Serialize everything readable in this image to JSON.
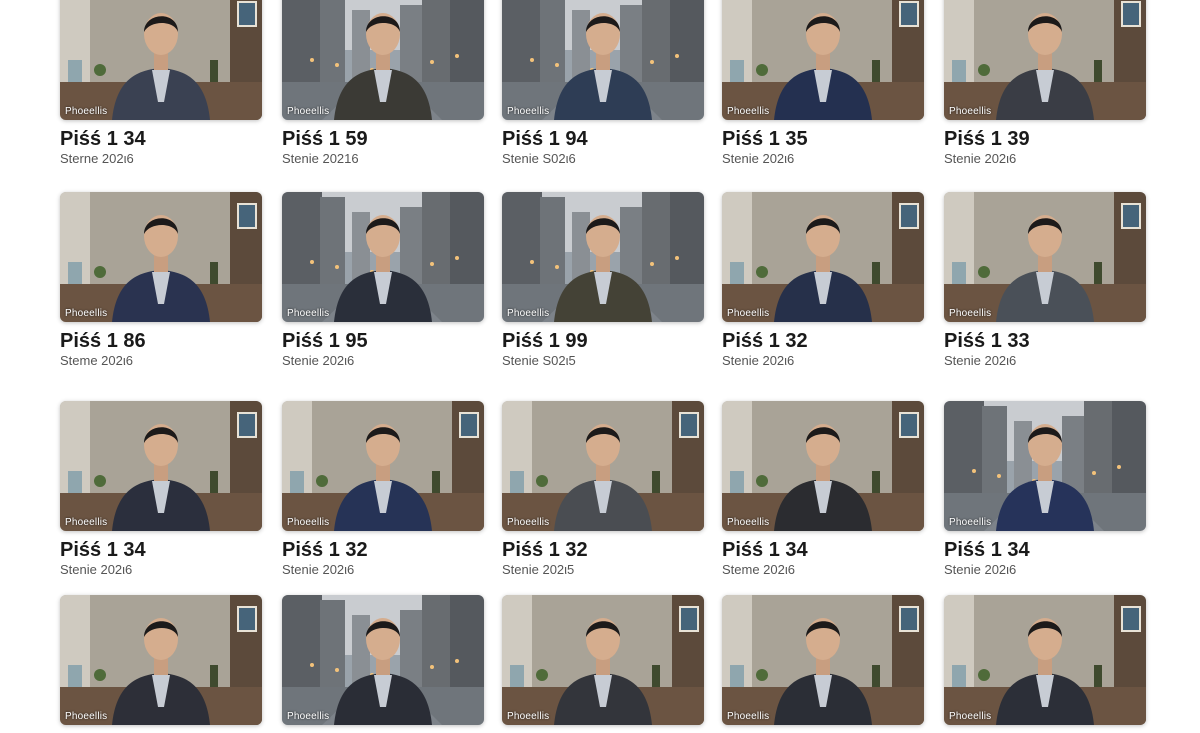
{
  "gallery": {
    "badge_label": "Phoeellis",
    "items": [
      {
        "title": "Piśś 1 34",
        "subtitle": "Sterne 202ι6",
        "scene": "office",
        "shirt": "#3a4152"
      },
      {
        "title": "Piśś 1 59",
        "subtitle": "Stenie 20216",
        "scene": "street",
        "shirt": "#3b3a35"
      },
      {
        "title": "Piśś 1 94",
        "subtitle": "Stenie S02ι6",
        "scene": "street",
        "shirt": "#2e3d55"
      },
      {
        "title": "Piśś 1 35",
        "subtitle": "Stenie 202ι6",
        "scene": "office",
        "shirt": "#243050"
      },
      {
        "title": "Piśś 1 39",
        "subtitle": "Stenie 202ι6",
        "scene": "office",
        "shirt": "#3a3d45"
      },
      {
        "title": "Piśś 1 86",
        "subtitle": "Steme 202ι6",
        "scene": "office",
        "shirt": "#2a3350"
      },
      {
        "title": "Piśś 1 95",
        "subtitle": "Stenie 202ι6",
        "scene": "street",
        "shirt": "#2a2f3a"
      },
      {
        "title": "Piśś 1 99",
        "subtitle": "Stenie S02ι5",
        "scene": "street",
        "shirt": "#444236"
      },
      {
        "title": "Piśś 1 32",
        "subtitle": "Stenie 202ι6",
        "scene": "office",
        "shirt": "#26304a"
      },
      {
        "title": "Piśś 1 33",
        "subtitle": "Stenie 202ι6",
        "scene": "office",
        "shirt": "#4a5058"
      },
      {
        "title": "Piśś 1 34",
        "subtitle": "Stenie 202ι6",
        "scene": "office",
        "shirt": "#2b2f3d"
      },
      {
        "title": "Piśś 1 32",
        "subtitle": "Stenie 202ι6",
        "scene": "office",
        "shirt": "#263356"
      },
      {
        "title": "Piśś 1 32",
        "subtitle": "Stenie 202ι5",
        "scene": "office",
        "shirt": "#4a4d52"
      },
      {
        "title": "Piśś 1 34",
        "subtitle": "Steme 202ι6",
        "scene": "office",
        "shirt": "#2b2c30"
      },
      {
        "title": "Piśś 1 34",
        "subtitle": "Stenie 202ι6",
        "scene": "street",
        "shirt": "#26335a"
      },
      {
        "title": "",
        "subtitle": "",
        "scene": "office",
        "shirt": "#2d2f38"
      },
      {
        "title": "",
        "subtitle": "",
        "scene": "street",
        "shirt": "#2a2d36"
      },
      {
        "title": "",
        "subtitle": "",
        "scene": "office",
        "shirt": "#33353b"
      },
      {
        "title": "",
        "subtitle": "",
        "scene": "office",
        "shirt": "#2b2e36"
      },
      {
        "title": "",
        "subtitle": "",
        "scene": "office",
        "shirt": "#2c2f38"
      }
    ]
  }
}
